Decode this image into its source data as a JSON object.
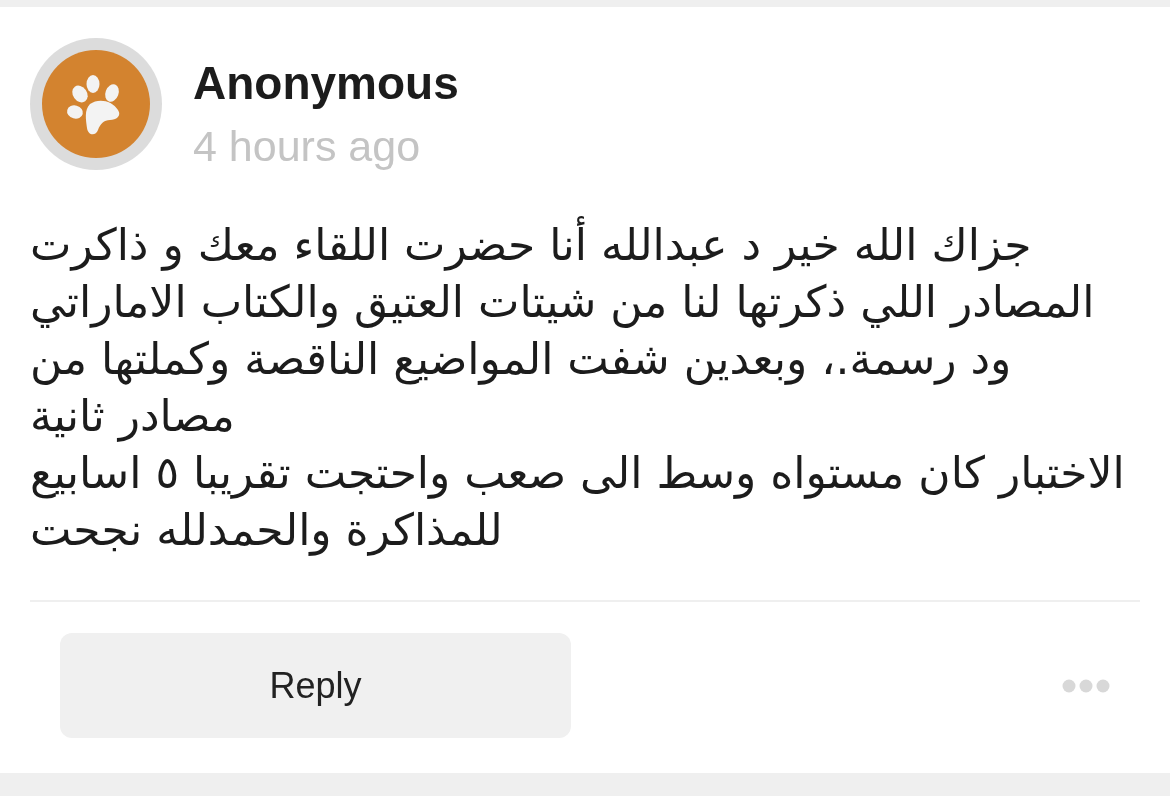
{
  "comment": {
    "author": "Anonymous",
    "time": "4 hours ago",
    "body": "جزاك الله خير د عبدالله أنا حضرت اللقاء معك و ذاكرت\nالمصادر اللي ذكرتها لنا من شيتات العتيق والكتاب الاماراتي\nود رسمة.، وبعدين شفت المواضيع الناقصة وكملتها من\nمصادر ثانية\nالاختبار كان مستواه وسط الى صعب واحتجت تقريبا ٥ اسابيع\nللمذاكرة والحمدلله نجحت"
  },
  "actions": {
    "reply": "Reply"
  }
}
